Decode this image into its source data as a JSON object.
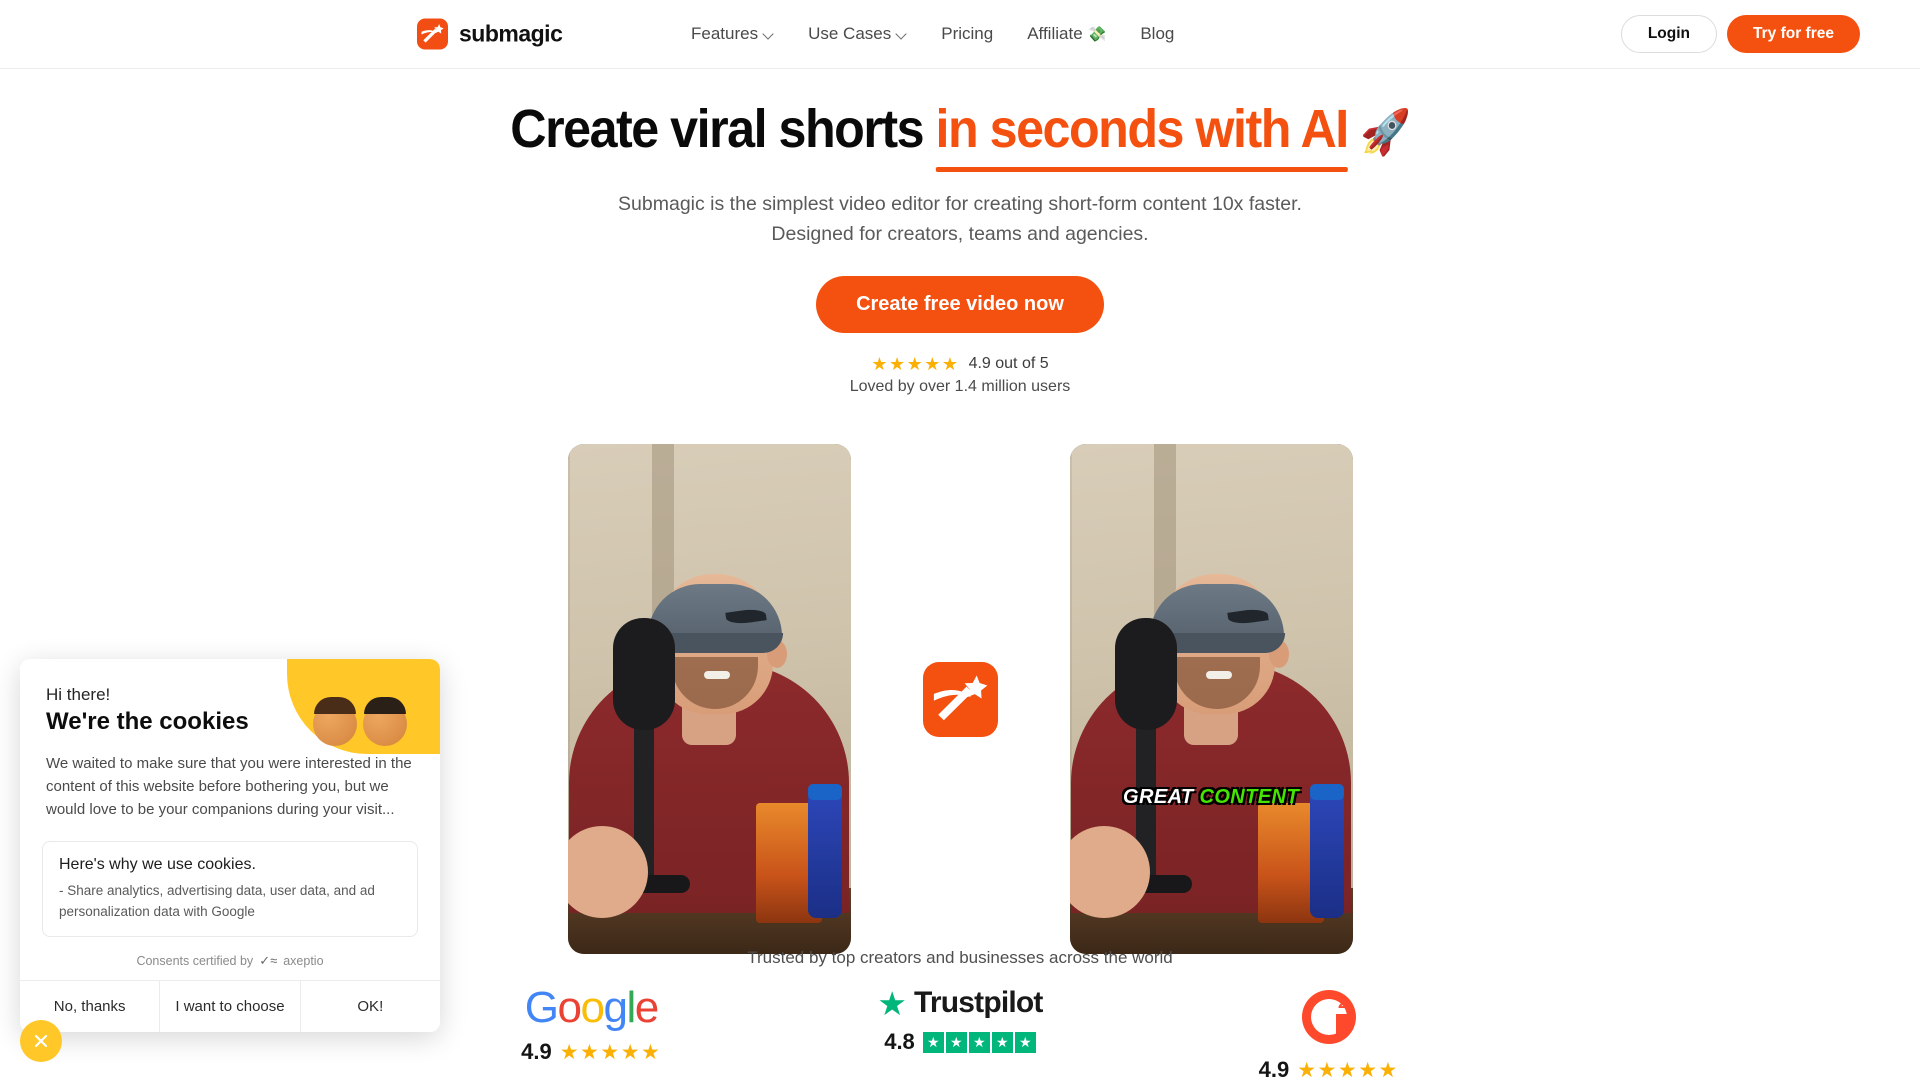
{
  "header": {
    "brand": {
      "name": "submagic",
      "icon": "magic-wand-icon"
    },
    "nav": [
      {
        "label": "Features",
        "has_dropdown": true
      },
      {
        "label": "Use Cases",
        "has_dropdown": true
      },
      {
        "label": "Pricing",
        "has_dropdown": false
      },
      {
        "label": "Affiliate",
        "emoji": "💸",
        "has_dropdown": false
      },
      {
        "label": "Blog",
        "has_dropdown": false
      }
    ],
    "login_label": "Login",
    "try_label": "Try for free"
  },
  "hero": {
    "headline_plain": "Create viral shorts ",
    "headline_highlight": "in seconds with AI",
    "headline_emoji": "🚀",
    "subhead_line1": "Submagic is the simplest video editor for creating short-form content 10x faster.",
    "subhead_line2": "Designed for creators, teams and agencies.",
    "cta_label": "Create free video now",
    "stars": "★★★★★",
    "rating_text": "4.9 out of 5",
    "loved_text": "Loved by over 1.4 million users"
  },
  "compare": {
    "left_caption": "",
    "right_caption_word1": "GREAT",
    "right_caption_word2": "CONTENT",
    "center_icon": "submagic-logo-icon"
  },
  "trust": {
    "title": "Trusted by top creators and businesses across the world",
    "items": [
      {
        "brand": "Google",
        "score": "4.9",
        "stars": "★★★★★"
      },
      {
        "brand": "Trustpilot",
        "score": "4.8",
        "stars": "★★★★★"
      },
      {
        "brand": "G2",
        "score": "4.9",
        "stars": "★★★★★"
      }
    ],
    "google_letters": [
      "G",
      "o",
      "o",
      "g",
      "l",
      "e"
    ],
    "trustpilot_word": "Trustpilot",
    "g2_label": "G2"
  },
  "cookie": {
    "greeting": "Hi there!",
    "title": "We're the cookies",
    "body": "We waited to make sure that you were interested in the content of this website before bothering you, but we would love to be your companions during your visit...",
    "why_title": "Here's why we use cookies.",
    "why_item": "- Share analytics, advertising data, user data, and ad personalization data with Google",
    "certified": "Consents certified by",
    "certified_brand": "axeptio",
    "actions": [
      "No, thanks",
      "I want to choose",
      "OK!"
    ],
    "close_icon": "close-icon"
  },
  "colors": {
    "brand_orange": "#F4500F",
    "star_gold": "#FAB005",
    "trustpilot_green": "#00B67A",
    "cookie_yellow": "#FFC828",
    "caption_green": "#45E500"
  }
}
